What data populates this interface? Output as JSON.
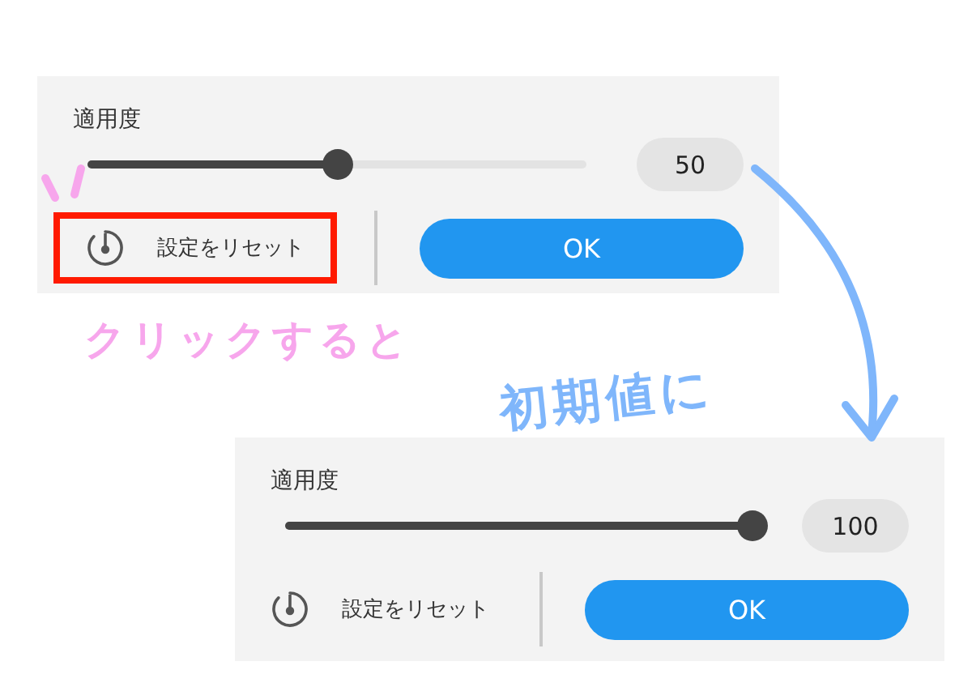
{
  "panels": [
    {
      "slider_label": "適用度",
      "level": 0.5,
      "value": "50",
      "reset_label": "設定をリセット",
      "ok_label": "OK",
      "highlighted": true
    },
    {
      "slider_label": "適用度",
      "level": 1,
      "value": "100",
      "reset_label": "設定をリセット",
      "ok_label": "OK",
      "highlighted": false
    }
  ],
  "annotations": [
    {
      "text": "クリックすると",
      "color": "#f7a6ec"
    },
    {
      "text": "初期値に",
      "color": "#7fb6fb"
    }
  ]
}
